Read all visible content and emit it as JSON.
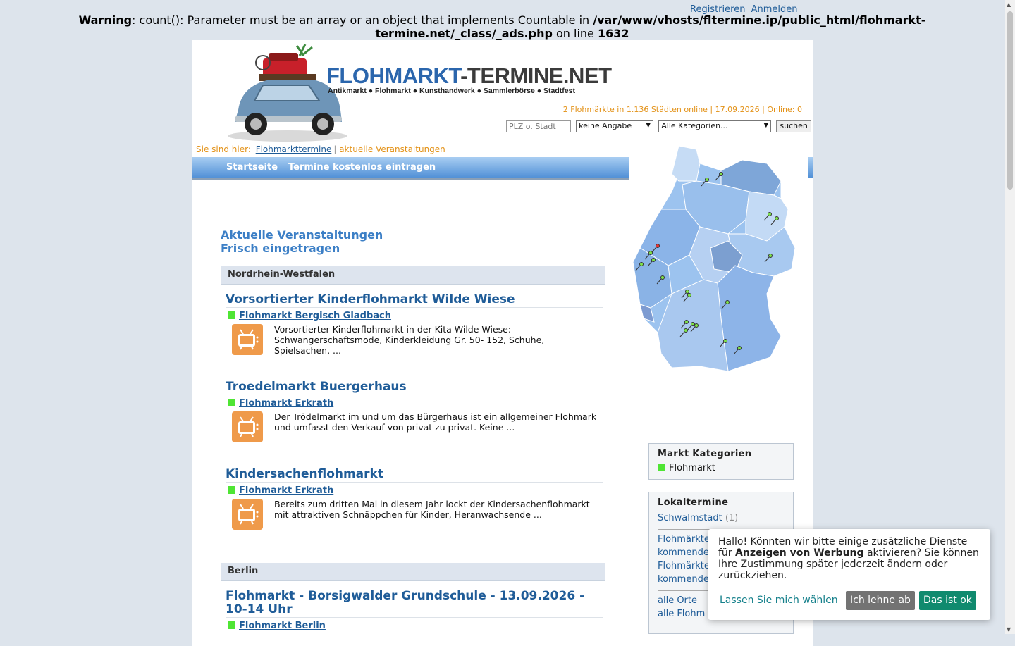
{
  "auth": {
    "register": "Registrieren",
    "login": "Anmelden"
  },
  "warning": {
    "label": "Warning",
    "text": ": count(): Parameter must be an array or an object that implements Countable in ",
    "path": "/var/www/vhosts/fltermine.ip/public_html/flohmarkt-termine.net/_class/_ads.php",
    "online": " on line ",
    "line": "1632"
  },
  "logo": {
    "part1": "FLOHMARKT",
    "dash": "-",
    "part2": "TERMINE.NET",
    "tagline": "Antikmarkt ● Flohmarkt ● Kunsthandwerk ● Sammlerbörse ● Stadtfest"
  },
  "stats": "2 Flohmärkte in 1.136 Städten online | 17.09.2026 | Online: 0",
  "search": {
    "placeholder": "PLZ o. Stadt",
    "distance_selected": "keine Angabe",
    "category_selected": "Alle Kategorien...",
    "submit": "suchen"
  },
  "breadcrumb": {
    "prefix": "Sie sind hier:",
    "home": "Flohmarkttermine",
    "separator": "|",
    "current": "aktuelle Veranstaltungen"
  },
  "nav": {
    "home": "Startseite",
    "add": "Termine kostenlos eintragen"
  },
  "headings": {
    "current": "Aktuelle Veranstaltungen",
    "fresh": "Frisch eingetragen"
  },
  "regions": {
    "nrw": "Nordrhein-Westfalen",
    "berlin": "Berlin"
  },
  "events": [
    {
      "title": "Vorsortierter Kinderflohmarkt Wilde Wiese",
      "city": "Flohmarkt Bergisch Gladbach",
      "desc": "Vorsortierter Kinderflohmarkt in der Kita Wilde Wiese: Schwangerschaftsmode, Kinderkleidung Gr. 50- 152, Schuhe, Spielsachen, ..."
    },
    {
      "title": "Troedelmarkt Buergerhaus",
      "city": "Flohmarkt Erkrath",
      "desc": "Der Trödelmarkt im und um das Bürgerhaus ist ein allgemeiner Flohmark und umfasst den Verkauf von privat zu privat. Keine ..."
    },
    {
      "title": "Kindersachenflohmarkt",
      "city": "Flohmarkt Erkrath",
      "desc": "Bereits zum dritten Mal in diesem Jahr lockt der  Kindersachenflohmarkt mit attraktiven Schnäppchen für Kinder, Heranwachsende ..."
    },
    {
      "title": "Flohmarkt - Borsigwalder Grundschule - 13.09.2026 - 10-14 Uhr",
      "city": "Flohmarkt Berlin",
      "desc": ""
    }
  ],
  "categories_box": {
    "title": "Markt Kategorien",
    "items": [
      "Flohmarkt"
    ]
  },
  "local_box": {
    "title": "Lokaltermine",
    "town": "Schwalmstadt",
    "town_count": "(1)",
    "links": [
      "Flohmärkte",
      "kommenden",
      "Flohmärkte",
      "kommenden"
    ],
    "all_places": "alle Orte",
    "all_markets": "alle Flohm"
  },
  "cookie": {
    "msg_a": "Hallo! Könnten wir bitte einige zusätzliche Dienste für ",
    "msg_bold": "Anzeigen von Werbung",
    "msg_b": " aktivieren? Sie können Ihre Zustimmung später jederzeit ändern oder zurückziehen.",
    "choose": "Lassen Sie mich wählen",
    "decline": "Ich lehne ab",
    "accept": "Das ist ok"
  },
  "colors": {
    "link_blue": "#1f5c98",
    "orange": "#e39116",
    "category_green": "#4fe534",
    "accept_green": "#108a6e"
  }
}
